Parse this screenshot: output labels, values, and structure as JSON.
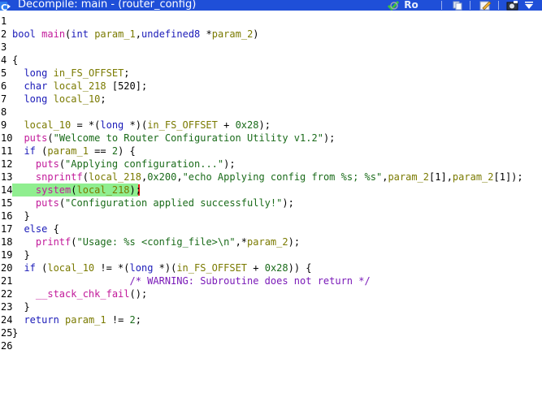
{
  "window": {
    "title": "Decompile: main -  (router_config)",
    "readonly_badge": "Ro"
  },
  "colors": {
    "titlebar": "#1f4fd8",
    "highlight": "#90ee90",
    "cursor": "#e01b1b",
    "keyword": "#1a1ab8",
    "function": "#c21a9a",
    "variable": "#7a7a00",
    "string": "#1a6b1a",
    "comment": "#7a1ab8"
  },
  "toolbar": {
    "icons": [
      "refresh-icon",
      "readonly-icon",
      "copy-icon",
      "snapshot-edit-icon",
      "export-icon",
      "menu-icon"
    ]
  },
  "code": {
    "highlighted_line": 14,
    "lines": [
      {
        "n": "1",
        "tokens": []
      },
      {
        "n": "2",
        "tokens": [
          [
            "kw",
            "bool"
          ],
          [
            "p",
            " "
          ],
          [
            "fn",
            "main"
          ],
          [
            "p",
            "("
          ],
          [
            "kw",
            "int"
          ],
          [
            "p",
            " "
          ],
          [
            "var",
            "param_1"
          ],
          [
            "p",
            ","
          ],
          [
            "kw",
            "undefined8"
          ],
          [
            "p",
            " *"
          ],
          [
            "var",
            "param_2"
          ],
          [
            "p",
            ")"
          ]
        ]
      },
      {
        "n": "3",
        "tokens": []
      },
      {
        "n": "4",
        "tokens": [
          [
            "p",
            "{"
          ]
        ]
      },
      {
        "n": "5",
        "tokens": [
          [
            "p",
            "  "
          ],
          [
            "kw",
            "long"
          ],
          [
            "p",
            " "
          ],
          [
            "var",
            "in_FS_OFFSET"
          ],
          [
            "p",
            ";"
          ]
        ]
      },
      {
        "n": "6",
        "tokens": [
          [
            "p",
            "  "
          ],
          [
            "kw",
            "char"
          ],
          [
            "p",
            " "
          ],
          [
            "var",
            "local_218"
          ],
          [
            "p",
            " [520];"
          ]
        ]
      },
      {
        "n": "7",
        "tokens": [
          [
            "p",
            "  "
          ],
          [
            "kw",
            "long"
          ],
          [
            "p",
            " "
          ],
          [
            "var",
            "local_10"
          ],
          [
            "p",
            ";"
          ]
        ]
      },
      {
        "n": "8",
        "tokens": []
      },
      {
        "n": "9",
        "tokens": [
          [
            "p",
            "  "
          ],
          [
            "var",
            "local_10"
          ],
          [
            "p",
            " = *("
          ],
          [
            "kw",
            "long"
          ],
          [
            "p",
            " *)("
          ],
          [
            "var",
            "in_FS_OFFSET"
          ],
          [
            "p",
            " + "
          ],
          [
            "num",
            "0x28"
          ],
          [
            "p",
            ");"
          ]
        ]
      },
      {
        "n": "10",
        "tokens": [
          [
            "p",
            "  "
          ],
          [
            "fn",
            "puts"
          ],
          [
            "p",
            "("
          ],
          [
            "str",
            "\"Welcome to Router Configuration Utility v1.2\""
          ],
          [
            "p",
            ");"
          ]
        ]
      },
      {
        "n": "11",
        "tokens": [
          [
            "p",
            "  "
          ],
          [
            "kw",
            "if"
          ],
          [
            "p",
            " ("
          ],
          [
            "var",
            "param_1"
          ],
          [
            "p",
            " == "
          ],
          [
            "num",
            "2"
          ],
          [
            "p",
            ") {"
          ]
        ]
      },
      {
        "n": "12",
        "tokens": [
          [
            "p",
            "    "
          ],
          [
            "fn",
            "puts"
          ],
          [
            "p",
            "("
          ],
          [
            "str",
            "\"Applying configuration...\""
          ],
          [
            "p",
            ");"
          ]
        ]
      },
      {
        "n": "13",
        "tokens": [
          [
            "p",
            "    "
          ],
          [
            "fn",
            "snprintf"
          ],
          [
            "p",
            "("
          ],
          [
            "var",
            "local_218"
          ],
          [
            "p",
            ","
          ],
          [
            "num",
            "0x200"
          ],
          [
            "p",
            ","
          ],
          [
            "str",
            "\"echo Applying config from %s; %s\""
          ],
          [
            "p",
            ","
          ],
          [
            "var",
            "param_2"
          ],
          [
            "p",
            "[1],"
          ],
          [
            "var",
            "param_2"
          ],
          [
            "p",
            "[1]);"
          ]
        ]
      },
      {
        "n": "14",
        "tokens": [
          [
            "p",
            "    "
          ],
          [
            "fn",
            "system"
          ],
          [
            "p",
            "("
          ],
          [
            "var",
            "local_218"
          ],
          [
            "p",
            ");"
          ]
        ]
      },
      {
        "n": "15",
        "tokens": [
          [
            "p",
            "    "
          ],
          [
            "fn",
            "puts"
          ],
          [
            "p",
            "("
          ],
          [
            "str",
            "\"Configuration applied successfully!\""
          ],
          [
            "p",
            ");"
          ]
        ]
      },
      {
        "n": "16",
        "tokens": [
          [
            "p",
            "  }"
          ]
        ]
      },
      {
        "n": "17",
        "tokens": [
          [
            "p",
            "  "
          ],
          [
            "kw",
            "else"
          ],
          [
            "p",
            " {"
          ]
        ]
      },
      {
        "n": "18",
        "tokens": [
          [
            "p",
            "    "
          ],
          [
            "fn",
            "printf"
          ],
          [
            "p",
            "("
          ],
          [
            "str",
            "\"Usage: %s <config_file>\\n\""
          ],
          [
            "p",
            ",*"
          ],
          [
            "var",
            "param_2"
          ],
          [
            "p",
            ");"
          ]
        ]
      },
      {
        "n": "19",
        "tokens": [
          [
            "p",
            "  }"
          ]
        ]
      },
      {
        "n": "20",
        "tokens": [
          [
            "p",
            "  "
          ],
          [
            "kw",
            "if"
          ],
          [
            "p",
            " ("
          ],
          [
            "var",
            "local_10"
          ],
          [
            "p",
            " != *("
          ],
          [
            "kw",
            "long"
          ],
          [
            "p",
            " *)("
          ],
          [
            "var",
            "in_FS_OFFSET"
          ],
          [
            "p",
            " + "
          ],
          [
            "num",
            "0x28"
          ],
          [
            "p",
            ")) {"
          ]
        ]
      },
      {
        "n": "21",
        "tokens": [
          [
            "p",
            "                    "
          ],
          [
            "cmt",
            "/* WARNING: Subroutine does not return */"
          ]
        ]
      },
      {
        "n": "22",
        "tokens": [
          [
            "p",
            "    "
          ],
          [
            "fn",
            "__stack_chk_fail"
          ],
          [
            "p",
            "();"
          ]
        ]
      },
      {
        "n": "23",
        "tokens": [
          [
            "p",
            "  }"
          ]
        ]
      },
      {
        "n": "24",
        "tokens": [
          [
            "p",
            "  "
          ],
          [
            "kw",
            "return"
          ],
          [
            "p",
            " "
          ],
          [
            "var",
            "param_1"
          ],
          [
            "p",
            " != "
          ],
          [
            "num",
            "2"
          ],
          [
            "p",
            ";"
          ]
        ]
      },
      {
        "n": "25",
        "tokens": [
          [
            "p",
            "}"
          ]
        ]
      },
      {
        "n": "26",
        "tokens": []
      }
    ]
  }
}
